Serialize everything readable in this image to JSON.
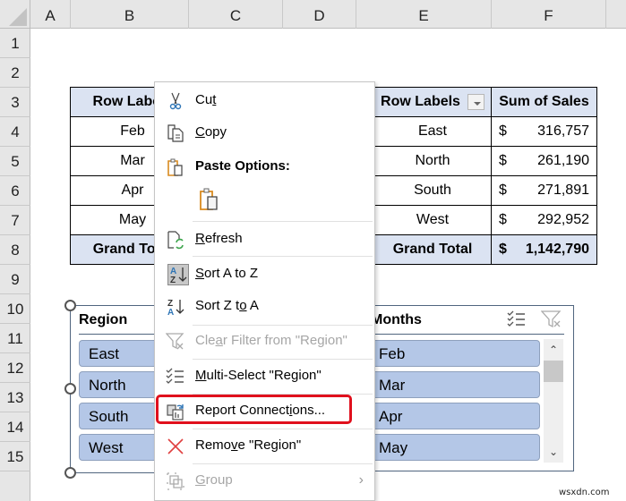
{
  "columns": [
    "A",
    "B",
    "C",
    "D",
    "E",
    "F"
  ],
  "rows": [
    "1",
    "2",
    "3",
    "4",
    "5",
    "6",
    "7",
    "8",
    "9",
    "10",
    "11",
    "12",
    "13",
    "14",
    "15"
  ],
  "pivot_months": {
    "header": "Row Labels",
    "rows": [
      "Feb",
      "Mar",
      "Apr",
      "May"
    ],
    "total_label": "Grand Total"
  },
  "pivot_regions": {
    "header_label": "Row Labels",
    "header_value": "Sum of Sales",
    "rows": [
      {
        "label": "East",
        "currency": "$",
        "value": "316,757"
      },
      {
        "label": "North",
        "currency": "$",
        "value": "261,190"
      },
      {
        "label": "South",
        "currency": "$",
        "value": "271,891"
      },
      {
        "label": "West",
        "currency": "$",
        "value": "292,952"
      }
    ],
    "total": {
      "label": "Grand Total",
      "currency": "$",
      "value": "1,142,790"
    }
  },
  "slicer_region": {
    "title": "Region",
    "items": [
      "East",
      "North",
      "South",
      "West"
    ]
  },
  "slicer_months": {
    "title": "Months",
    "items": [
      "Feb",
      "Mar",
      "Apr",
      "May"
    ]
  },
  "context_menu": {
    "cut": {
      "pre": "Cu",
      "u": "t",
      "post": ""
    },
    "copy": {
      "pre": "",
      "u": "C",
      "post": "opy"
    },
    "paste_options": "Paste Options:",
    "refresh": {
      "pre": "",
      "u": "R",
      "post": "efresh"
    },
    "sort_az": {
      "pre": "",
      "u": "S",
      "post": "ort A to Z"
    },
    "sort_za": {
      "pre": "Sort Z t",
      "u": "o",
      "post": " A"
    },
    "clear_filter": {
      "pre": "Cle",
      "u": "a",
      "post": "r Filter from \"Region\""
    },
    "multi_select": {
      "pre": "",
      "u": "M",
      "post": "ulti-Select \"Region\""
    },
    "report_connections": {
      "pre": "Report Connect",
      "u": "i",
      "post": "ons..."
    },
    "remove": {
      "pre": "Remo",
      "u": "v",
      "post": "e \"Region\""
    },
    "group": {
      "pre": "",
      "u": "G",
      "post": "roup"
    }
  },
  "colors": {
    "highlight": "#e0101d",
    "header_fill": "#dbe3f2",
    "slicer_item": "#b4c7e7"
  },
  "watermark": "wsxdn.com"
}
